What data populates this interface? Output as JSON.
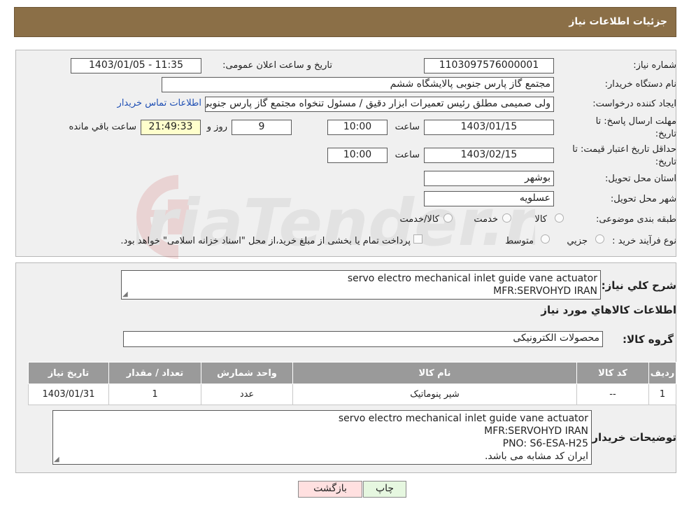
{
  "header": {
    "title": "جزئیات اطلاعات نیاز"
  },
  "form": {
    "need_number_label": "شماره نیاز:",
    "need_number": "1103097576000001",
    "announce_label": "تاریخ و ساعت اعلان عمومی:",
    "announce_value": "1403/01/05 - 11:35",
    "buyer_org_label": "نام دستگاه خریدار:",
    "buyer_org": "مجتمع گاز پارس جنوبی  پالایشگاه ششم",
    "creator_label": "ایجاد کننده درخواست:",
    "creator": "ولی صمیمی مطلق رئیس تعمیرات ابزار دقیق / مسئول تنخواه مجتمع گاز پارس جنوبی",
    "contact_link": "اطلاعات تماس خریدار",
    "deadline_label_1": "مهلت ارسال پاسخ: تا",
    "deadline_label_2": "تاریخ:",
    "deadline_date": "1403/01/15",
    "time_label": "ساعت",
    "deadline_time": "10:00",
    "days": "9",
    "days_label": "روز و",
    "remaining": "21:49:33",
    "remaining_label": "ساعت باقي مانده",
    "validity_label_1": "حداقل تاریخ اعتبار قیمت: تا",
    "validity_label_2": "تاریخ:",
    "validity_date": "1403/02/15",
    "validity_time": "10:00",
    "province_label": "استان محل تحویل:",
    "province": "بوشهر",
    "city_label": "شهر محل تحویل:",
    "city": "عسلویه",
    "category_label": "طبقه بندی موضوعی:",
    "category_options": [
      "کالا",
      "خدمت",
      "کالا/خدمت"
    ],
    "process_label": "نوع فرآیند خرید :",
    "process_options": [
      "جزیي",
      "متوسط"
    ],
    "payment_note": "پرداخت تمام یا بخشی از مبلغ خرید،از محل \"اسناد خزانه اسلامی\" خواهد بود."
  },
  "details": {
    "summary_label": "شرح کلي نياز:",
    "summary_lines": [
      "servo electro mechanical inlet guide vane actuator",
      "MFR:SERVOHYD IRAN"
    ],
    "goods_info_title": "اطلاعات کالاهاي مورد نياز",
    "group_label": "گروه کالا:",
    "group_value": "محصولات الکترونیکی",
    "table": {
      "headers": [
        "رديف",
        "کد کالا",
        "نام کالا",
        "واحد شمارش",
        "تعداد / مقدار",
        "تاریخ نیاز"
      ],
      "rows": [
        [
          "1",
          "--",
          "شیر پنوماتیک",
          "عدد",
          "1",
          "1403/01/31"
        ]
      ]
    },
    "buyer_notes_label": "توضیحات خریدار:",
    "buyer_notes_lines": [
      "servo electro mechanical inlet guide vane actuator",
      "MFR:SERVOHYD IRAN",
      "PNO: S6-ESA-H25",
      "ایران کد مشابه می باشد."
    ]
  },
  "buttons": {
    "print": "چاپ",
    "back": "بازگشت"
  },
  "colors": {
    "header_bg": "#8b6f47",
    "back_button_bg": "#ffe0e0",
    "print_button_bg": "#e6f7e0"
  }
}
